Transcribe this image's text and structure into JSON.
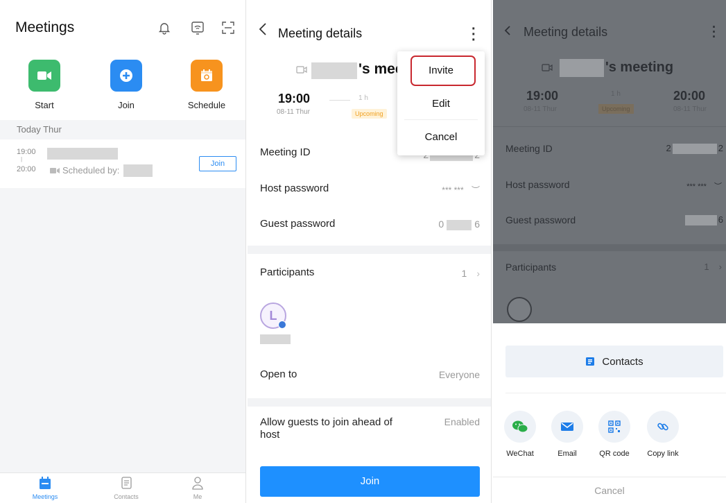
{
  "panel1": {
    "title": "Meetings",
    "icons": [
      "bell-icon",
      "cast-icon",
      "scan-icon"
    ],
    "actions": [
      {
        "label": "Start",
        "color": "#3dbb6e"
      },
      {
        "label": "Join",
        "color": "#2b8cf2"
      },
      {
        "label": "Schedule",
        "color": "#f7931e"
      }
    ],
    "section": "Today Thur",
    "meeting": {
      "start": "19:00",
      "end": "20:00",
      "scheduled_by": "Scheduled by:",
      "join_label": "Join"
    },
    "nav": [
      {
        "label": "Meetings",
        "active": true
      },
      {
        "label": "Contacts",
        "active": false
      },
      {
        "label": "Me",
        "active": false
      }
    ]
  },
  "panel2": {
    "title": "Meeting details",
    "meeting_name_suffix": "'s mee",
    "start_time": "19:00",
    "start_date": "08-11 Thur",
    "duration": "1 h",
    "status": "Upcoming",
    "menu": [
      "Invite",
      "Edit",
      "Cancel"
    ],
    "rows": {
      "meeting_id": {
        "label": "Meeting ID",
        "value_start": "2",
        "value_end": "2"
      },
      "host_password": {
        "label": "Host password",
        "value": "*** ***"
      },
      "guest_password": {
        "label": "Guest password",
        "value_start": "0",
        "value_end": "6"
      },
      "participants": {
        "label": "Participants",
        "count": "1"
      },
      "avatar_letter": "L",
      "open_to": {
        "label": "Open to",
        "value": "Everyone"
      },
      "allow_guests": {
        "label": "Allow guests to join ahead of host",
        "value": "Enabled"
      }
    },
    "join_button": "Join",
    "accent": "#1e90ff"
  },
  "panel3": {
    "title": "Meeting details",
    "meeting_name_suffix": "'s meeting",
    "start_time": "19:00",
    "start_date": "08-11 Thur",
    "end_time": "20:00",
    "end_date": "08-11 Thur",
    "duration": "1 h",
    "status": "Upcoming",
    "rows": {
      "meeting_id": {
        "label": "Meeting ID",
        "value_start": "2",
        "value_end": "2"
      },
      "host_password": {
        "label": "Host password",
        "value": "*** ***"
      },
      "guest_password": {
        "label": "Guest password",
        "value_end": "6"
      },
      "participants": {
        "label": "Participants",
        "count": "1"
      }
    },
    "contacts_button": "Contacts",
    "share_options": [
      {
        "label": "WeChat",
        "icon": "wechat-icon"
      },
      {
        "label": "Email",
        "icon": "email-icon"
      },
      {
        "label": "QR code",
        "icon": "qr-code-icon"
      },
      {
        "label": "Copy link",
        "icon": "link-icon"
      }
    ],
    "cancel": "Cancel"
  }
}
